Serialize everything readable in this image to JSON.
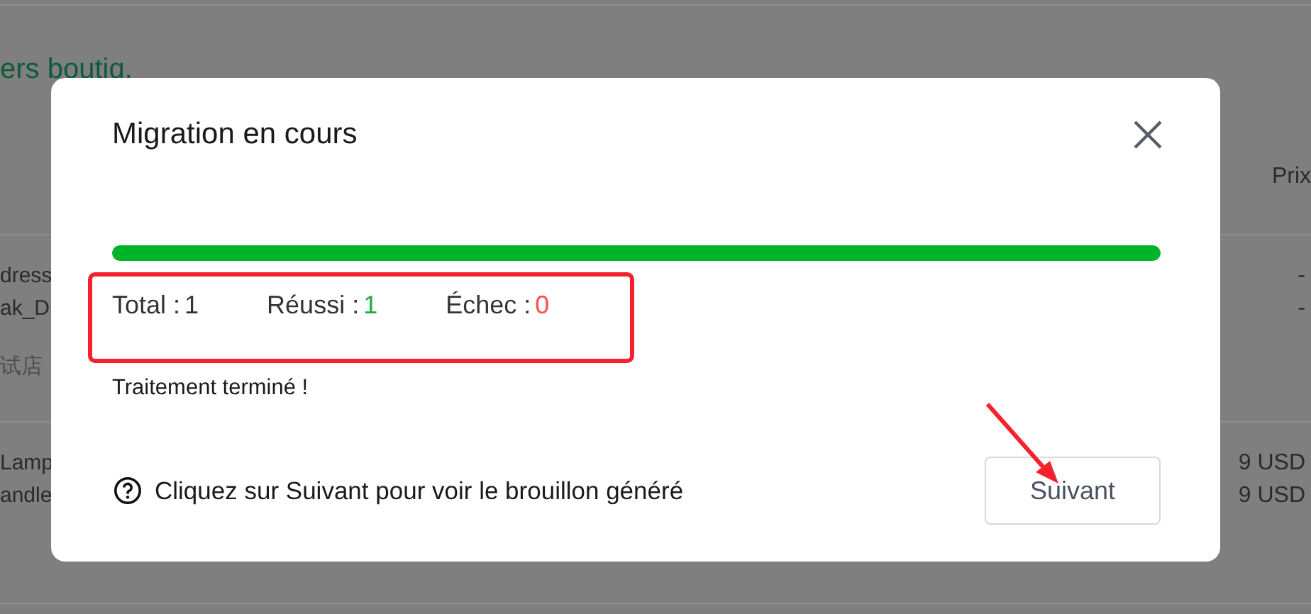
{
  "background": {
    "link": "ers boutiq.",
    "column_header": "Prix",
    "rows": [
      {
        "lines": [
          "dress",
          "ak_D"
        ],
        "store": "试店",
        "prices": [
          "-",
          "-"
        ]
      },
      {
        "lines": [
          "Lamp",
          "andle"
        ],
        "prices": [
          "9 USD",
          "9 USD"
        ]
      }
    ]
  },
  "dialog": {
    "title": "Migration en cours",
    "progress": {
      "level": 1
    },
    "stats": [
      {
        "label": "Total :",
        "value": "1",
        "color": "#333333"
      },
      {
        "label": "Réussi :",
        "value": "1",
        "color": "#1aad3a"
      },
      {
        "label": "Échec :",
        "value": "0",
        "color": "#ff4d4f"
      }
    ],
    "message": "Traitement terminé !",
    "hint": "Cliquez sur Suivant pour voir le brouillon généré",
    "button": "Suivant"
  }
}
